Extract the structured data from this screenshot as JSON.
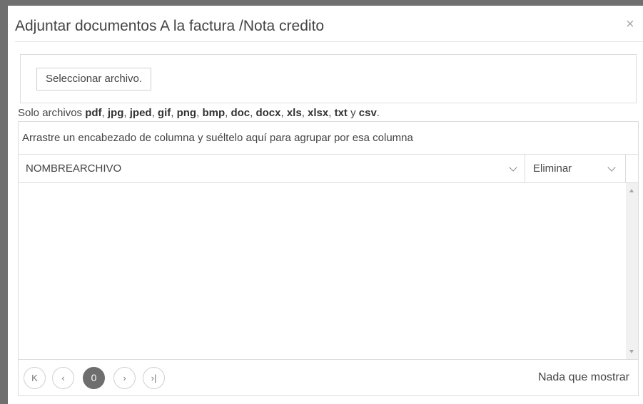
{
  "dialog": {
    "title": "Adjuntar documentos A la factura /Nota credito",
    "close_icon": "×"
  },
  "upload": {
    "select_button_label": "Seleccionar archivo.",
    "hint_prefix": "Solo archivos ",
    "file_types": [
      "pdf",
      "jpg",
      "jped",
      "gif",
      "png",
      "bmp",
      "doc",
      "docx",
      "xls",
      "xlsx",
      "txt",
      "csv"
    ],
    "separator": ", ",
    "conjunction": " y ",
    "hint_suffix": "."
  },
  "grid": {
    "group_panel_text": "Arrastre un encabezado de columna y suéltelo aquí para agrupar por esa columna",
    "columns": [
      {
        "label": "NOMBREARCHIVO"
      },
      {
        "label": "Eliminar"
      }
    ],
    "rows": []
  },
  "pager": {
    "first_icon": "K",
    "prev_icon": "‹",
    "current_page": "0",
    "next_icon": "›",
    "last_icon": "›|",
    "info": "Nada que mostrar"
  }
}
